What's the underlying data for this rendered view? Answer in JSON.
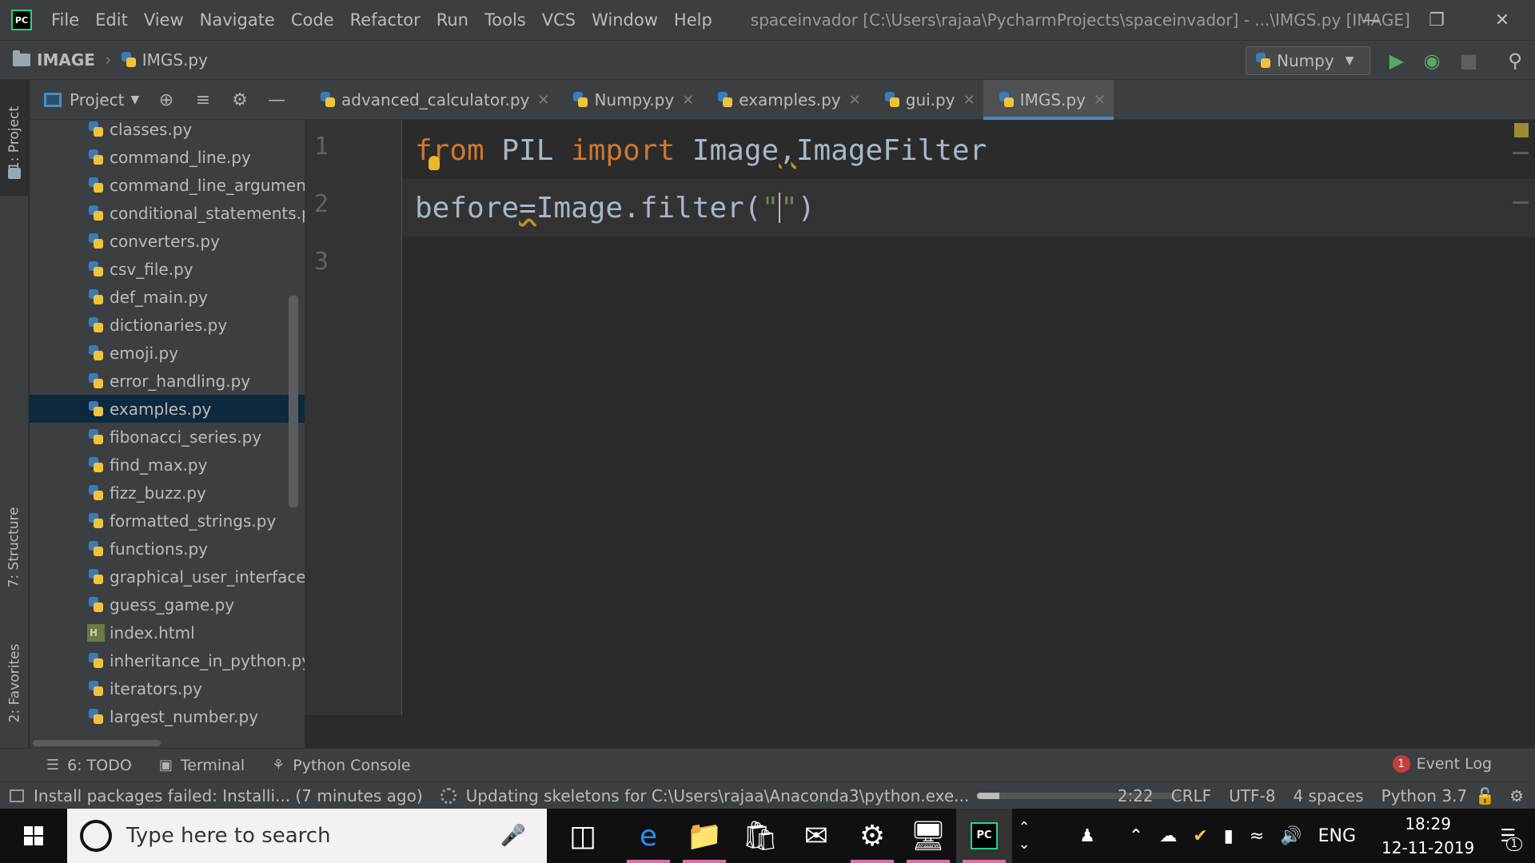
{
  "app": {
    "logo_text": "PC",
    "window_title": "spaceinvador [C:\\Users\\rajaa\\PycharmProjects\\spaceinvador] - ...\\IMGS.py [IMAGE]"
  },
  "menu": [
    "File",
    "Edit",
    "View",
    "Navigate",
    "Code",
    "Refactor",
    "Run",
    "Tools",
    "VCS",
    "Window",
    "Help"
  ],
  "navbar": {
    "breadcrumb_root": "IMAGE",
    "breadcrumb_file": "IMGS.py",
    "run_config": "Numpy"
  },
  "left_strip": {
    "project": "1: Project",
    "structure": "7: Structure",
    "favorites": "2: Favorites"
  },
  "project_panel": {
    "title": "Project",
    "files": [
      "classes.py",
      "command_line.py",
      "command_line_arguments",
      "conditional_statements.py",
      "converters.py",
      "csv_file.py",
      "def_main.py",
      "dictionaries.py",
      "emoji.py",
      "error_handling.py",
      "examples.py",
      "fibonacci_series.py",
      "find_max.py",
      "fizz_buzz.py",
      "formatted_strings.py",
      "functions.py",
      "graphical_user_interface.py",
      "guess_game.py",
      "index.html",
      "inheritance_in_python.py",
      "iterators.py",
      "largest_number.py"
    ],
    "selected": "examples.py"
  },
  "tabs": [
    "advanced_calculator.py",
    "Numpy.py",
    "examples.py",
    "gui.py",
    "IMGS.py"
  ],
  "active_tab": "IMGS.py",
  "editor": {
    "line_numbers": [
      "1",
      "2",
      "3"
    ],
    "line1": {
      "kw1": "from",
      "mod": " PIL ",
      "kw2": "import",
      "rest1": " Image",
      "comma": ",",
      "rest2": "ImageFilter"
    },
    "line2": {
      "var": "before",
      "eq": "=",
      "call": "Image.filter(",
      "q1": "\"",
      "q2": "\"",
      "close": ")"
    }
  },
  "bottom_tools": {
    "todo": "6: TODO",
    "terminal": "Terminal",
    "console": "Python Console",
    "event_log": "Event Log",
    "event_count": "1"
  },
  "status": {
    "message": "Install packages failed: Installi... (7 minutes ago)",
    "progress_text": "Updating skeletons for C:\\Users\\rajaa\\Anaconda3\\python.exe...",
    "progress": 0.11,
    "position": "2:22",
    "line_sep": "CRLF",
    "encoding": "UTF-8",
    "indent": "4 spaces",
    "interpreter": "Python 3.7"
  },
  "taskbar": {
    "search_placeholder": "Type here to search",
    "lang": "ENG",
    "time": "18:29",
    "date": "12-11-2019",
    "notifications": "1"
  },
  "colors": {
    "keyword": "#cc7832",
    "string": "#6a8759",
    "identifier": "#a9b7c6",
    "accent": "#4a88c7"
  }
}
